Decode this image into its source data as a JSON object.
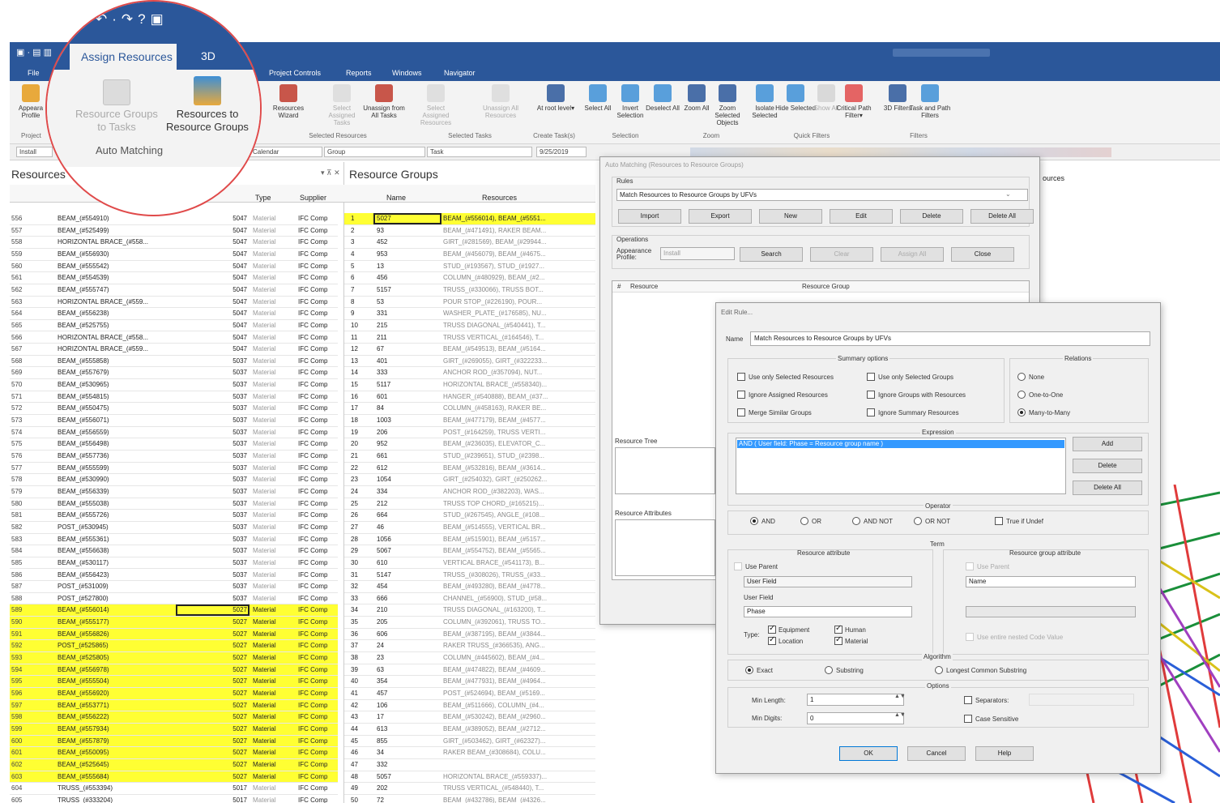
{
  "quick_access": {
    "undo": "↶",
    "redo": "↷",
    "help": "?"
  },
  "ribbon_tabs": {
    "file": "File",
    "assign": "Assign Resources",
    "view3d": "3D"
  },
  "menu": [
    "Project Controls",
    "Reports",
    "Windows",
    "Navigator"
  ],
  "ribbon": {
    "left_partial": [
      "Appeara",
      "Profile",
      "Project"
    ],
    "resource_groups_to_tasks": "Resource Groups to Tasks",
    "resources_to_resource_groups": "Resources to Resource Groups",
    "auto_matching": "Auto Matching",
    "buttons": [
      {
        "label": "Resources Wizard",
        "dis": false
      },
      {
        "label": "Select Assigned Tasks",
        "dis": true
      },
      {
        "label": "Unassign from All Tasks",
        "dis": false
      },
      {
        "label": "Select Assigned Resources",
        "dis": true
      },
      {
        "label": "Unassign All Resources",
        "dis": true
      },
      {
        "label": "At root level▾",
        "dis": false
      },
      {
        "label": "Select All",
        "dis": false
      },
      {
        "label": "Invert Selection",
        "dis": false
      },
      {
        "label": "Deselect All",
        "dis": false
      },
      {
        "label": "Zoom All",
        "dis": false
      },
      {
        "label": "Zoom Selected Objects",
        "dis": false
      },
      {
        "label": "Isolate Selected",
        "dis": false
      },
      {
        "label": "Hide Selected",
        "dis": false
      },
      {
        "label": "Show All",
        "dis": true
      },
      {
        "label": "Critical Path Filter▾",
        "dis": false
      },
      {
        "label": "3D Filters",
        "dis": false
      },
      {
        "label": "Task and Path Filters",
        "dis": false
      }
    ],
    "groups": [
      "Selected Resources",
      "Selected Tasks",
      "Create Task(s)",
      "Selection",
      "Zoom",
      "Quick Filters",
      "Filters"
    ]
  },
  "toolbar": {
    "install": "Install",
    "calendar": "Calendar",
    "group": "Group",
    "task": "Task",
    "date": "9/25/2019"
  },
  "resources_pane": {
    "title": "Resources",
    "search": "FS",
    "headers": {
      "type": "Type",
      "supplier": "Supplier"
    },
    "rows": [
      [
        "556",
        "BEAM_(#554910)",
        "5047",
        "Material",
        "IFC Comp",
        0
      ],
      [
        "557",
        "BEAM_(#525499)",
        "5047",
        "Material",
        "IFC Comp",
        0
      ],
      [
        "558",
        "HORIZONTAL BRACE_(#558...",
        "5047",
        "Material",
        "IFC Comp",
        0
      ],
      [
        "559",
        "BEAM_(#556930)",
        "5047",
        "Material",
        "IFC Comp",
        0
      ],
      [
        "560",
        "BEAM_(#555542)",
        "5047",
        "Material",
        "IFC Comp",
        0
      ],
      [
        "561",
        "BEAM_(#554539)",
        "5047",
        "Material",
        "IFC Comp",
        0
      ],
      [
        "562",
        "BEAM_(#555747)",
        "5047",
        "Material",
        "IFC Comp",
        0
      ],
      [
        "563",
        "HORIZONTAL BRACE_(#559...",
        "5047",
        "Material",
        "IFC Comp",
        0
      ],
      [
        "564",
        "BEAM_(#556238)",
        "5047",
        "Material",
        "IFC Comp",
        0
      ],
      [
        "565",
        "BEAM_(#525755)",
        "5047",
        "Material",
        "IFC Comp",
        0
      ],
      [
        "566",
        "HORIZONTAL BRACE_(#558...",
        "5047",
        "Material",
        "IFC Comp",
        0
      ],
      [
        "567",
        "HORIZONTAL BRACE_(#559...",
        "5047",
        "Material",
        "IFC Comp",
        0
      ],
      [
        "568",
        "BEAM_(#555858)",
        "5037",
        "Material",
        "IFC Comp",
        0
      ],
      [
        "569",
        "BEAM_(#557679)",
        "5037",
        "Material",
        "IFC Comp",
        0
      ],
      [
        "570",
        "BEAM_(#530965)",
        "5037",
        "Material",
        "IFC Comp",
        0
      ],
      [
        "571",
        "BEAM_(#554815)",
        "5037",
        "Material",
        "IFC Comp",
        0
      ],
      [
        "572",
        "BEAM_(#550475)",
        "5037",
        "Material",
        "IFC Comp",
        0
      ],
      [
        "573",
        "BEAM_(#556071)",
        "5037",
        "Material",
        "IFC Comp",
        0
      ],
      [
        "574",
        "BEAM_(#556559)",
        "5037",
        "Material",
        "IFC Comp",
        0
      ],
      [
        "575",
        "BEAM_(#556498)",
        "5037",
        "Material",
        "IFC Comp",
        0
      ],
      [
        "576",
        "BEAM_(#557736)",
        "5037",
        "Material",
        "IFC Comp",
        0
      ],
      [
        "577",
        "BEAM_(#555599)",
        "5037",
        "Material",
        "IFC Comp",
        0
      ],
      [
        "578",
        "BEAM_(#530990)",
        "5037",
        "Material",
        "IFC Comp",
        0
      ],
      [
        "579",
        "BEAM_(#556339)",
        "5037",
        "Material",
        "IFC Comp",
        0
      ],
      [
        "580",
        "BEAM_(#555038)",
        "5037",
        "Material",
        "IFC Comp",
        0
      ],
      [
        "581",
        "BEAM_(#555726)",
        "5037",
        "Material",
        "IFC Comp",
        0
      ],
      [
        "582",
        "POST_(#530945)",
        "5037",
        "Material",
        "IFC Comp",
        0
      ],
      [
        "583",
        "BEAM_(#555361)",
        "5037",
        "Material",
        "IFC Comp",
        0
      ],
      [
        "584",
        "BEAM_(#556638)",
        "5037",
        "Material",
        "IFC Comp",
        0
      ],
      [
        "585",
        "BEAM_(#530117)",
        "5037",
        "Material",
        "IFC Comp",
        0
      ],
      [
        "586",
        "BEAM_(#556423)",
        "5037",
        "Material",
        "IFC Comp",
        0
      ],
      [
        "587",
        "POST_(#531009)",
        "5037",
        "Material",
        "IFC Comp",
        0
      ],
      [
        "588",
        "POST_(#527800)",
        "5037",
        "Material",
        "IFC Comp",
        0
      ],
      [
        "589",
        "BEAM_(#556014)",
        "5027",
        "Material",
        "IFC Comp",
        1
      ],
      [
        "590",
        "BEAM_(#555177)",
        "5027",
        "Material",
        "IFC Comp",
        1
      ],
      [
        "591",
        "BEAM_(#556826)",
        "5027",
        "Material",
        "IFC Comp",
        1
      ],
      [
        "592",
        "POST_(#525865)",
        "5027",
        "Material",
        "IFC Comp",
        1
      ],
      [
        "593",
        "BEAM_(#525805)",
        "5027",
        "Material",
        "IFC Comp",
        1
      ],
      [
        "594",
        "BEAM_(#556978)",
        "5027",
        "Material",
        "IFC Comp",
        1
      ],
      [
        "595",
        "BEAM_(#555504)",
        "5027",
        "Material",
        "IFC Comp",
        1
      ],
      [
        "596",
        "BEAM_(#556920)",
        "5027",
        "Material",
        "IFC Comp",
        1
      ],
      [
        "597",
        "BEAM_(#553771)",
        "5027",
        "Material",
        "IFC Comp",
        1
      ],
      [
        "598",
        "BEAM_(#556222)",
        "5027",
        "Material",
        "IFC Comp",
        1
      ],
      [
        "599",
        "BEAM_(#557934)",
        "5027",
        "Material",
        "IFC Comp",
        1
      ],
      [
        "600",
        "BEAM_(#557879)",
        "5027",
        "Material",
        "IFC Comp",
        1
      ],
      [
        "601",
        "BEAM_(#550095)",
        "5027",
        "Material",
        "IFC Comp",
        1
      ],
      [
        "602",
        "BEAM_(#525645)",
        "5027",
        "Material",
        "IFC Comp",
        1
      ],
      [
        "603",
        "BEAM_(#555684)",
        "5027",
        "Material",
        "IFC Comp",
        1
      ],
      [
        "604",
        "TRUSS_(#553394)",
        "5017",
        "Material",
        "IFC Comp",
        0
      ],
      [
        "605",
        "TRUSS_(#333204)",
        "5017",
        "Material",
        "IFC Comp",
        0
      ]
    ]
  },
  "groups_pane": {
    "title": "Resource Groups",
    "headers": {
      "name": "Name",
      "resources": "Resources"
    },
    "rows": [
      [
        "1",
        "5027",
        "BEAM_(#556014), BEAM_(#5551...",
        1
      ],
      [
        "2",
        "93",
        "BEAM_(#471491), RAKER BEAM...",
        0
      ],
      [
        "3",
        "452",
        "GIRT_(#281569), BEAM_(#29944...",
        0
      ],
      [
        "4",
        "953",
        "BEAM_(#456079), BEAM_(#4675...",
        0
      ],
      [
        "5",
        "13",
        "STUD_(#193567), STUD_(#1927...",
        0
      ],
      [
        "6",
        "456",
        "COLUMN_(#480929), BEAM_(#2...",
        0
      ],
      [
        "7",
        "5157",
        "TRUSS_(#330066), TRUSS BOT...",
        0
      ],
      [
        "8",
        "53",
        "POUR STOP_(#226190), POUR...",
        0
      ],
      [
        "9",
        "331",
        "WASHER_PLATE_(#176585), NU...",
        0
      ],
      [
        "10",
        "215",
        "TRUSS DIAGONAL_(#540441), T...",
        0
      ],
      [
        "11",
        "211",
        "TRUSS VERTICAL_(#164546), T...",
        0
      ],
      [
        "12",
        "67",
        "BEAM_(#549513), BEAM_(#5164...",
        0
      ],
      [
        "13",
        "401",
        "GIRT_(#269055), GIRT_(#322233...",
        0
      ],
      [
        "14",
        "333",
        "ANCHOR ROD_(#357094), NUT...",
        0
      ],
      [
        "15",
        "5117",
        "HORIZONTAL BRACE_(#558340)...",
        0
      ],
      [
        "16",
        "601",
        "HANGER_(#540888), BEAM_(#37...",
        0
      ],
      [
        "17",
        "84",
        "COLUMN_(#458163), RAKER BE...",
        0
      ],
      [
        "18",
        "1003",
        "BEAM_(#477179), BEAM_(#4577...",
        0
      ],
      [
        "19",
        "206",
        "POST_(#164259), TRUSS VERTI...",
        0
      ],
      [
        "20",
        "952",
        "BEAM_(#236035), ELEVATOR_C...",
        0
      ],
      [
        "21",
        "661",
        "STUD_(#239651), STUD_(#2398...",
        0
      ],
      [
        "22",
        "612",
        "BEAM_(#532816), BEAM_(#3614...",
        0
      ],
      [
        "23",
        "1054",
        "GIRT_(#254032), GIRT_(#250262...",
        0
      ],
      [
        "24",
        "334",
        "ANCHOR ROD_(#382203), WAS...",
        0
      ],
      [
        "25",
        "212",
        "TRUSS TOP CHORD_(#165215)...",
        0
      ],
      [
        "26",
        "664",
        "STUD_(#267545), ANGLE_(#108...",
        0
      ],
      [
        "27",
        "46",
        "BEAM_(#514555), VERTICAL BR...",
        0
      ],
      [
        "28",
        "1056",
        "BEAM_(#515901), BEAM_(#5157...",
        0
      ],
      [
        "29",
        "5067",
        "BEAM_(#554752), BEAM_(#5565...",
        0
      ],
      [
        "30",
        "610",
        "VERTICAL BRACE_(#541173), B...",
        0
      ],
      [
        "31",
        "5147",
        "TRUSS_(#308026), TRUSS_(#33...",
        0
      ],
      [
        "32",
        "454",
        "BEAM_(#493280), BEAM_(#4778...",
        0
      ],
      [
        "33",
        "666",
        "CHANNEL_(#56900), STUD_(#58...",
        0
      ],
      [
        "34",
        "210",
        "TRUSS DIAGONAL_(#163200), T...",
        0
      ],
      [
        "35",
        "205",
        "COLUMN_(#392061), TRUSS TO...",
        0
      ],
      [
        "36",
        "606",
        "BEAM_(#387195), BEAM_(#3844...",
        0
      ],
      [
        "37",
        "24",
        "RAKER TRUSS_(#366535), ANG...",
        0
      ],
      [
        "38",
        "23",
        "COLUMN_(#445602), BEAM_(#4...",
        0
      ],
      [
        "39",
        "63",
        "BEAM_(#474822), BEAM_(#4609...",
        0
      ],
      [
        "40",
        "354",
        "BEAM_(#477931), BEAM_(#4964...",
        0
      ],
      [
        "41",
        "457",
        "POST_(#524694), BEAM_(#5169...",
        0
      ],
      [
        "42",
        "106",
        "BEAM_(#511666), COLUMN_(#4...",
        0
      ],
      [
        "43",
        "17",
        "BEAM_(#530242), BEAM_(#2960...",
        0
      ],
      [
        "44",
        "613",
        "BEAM_(#389052), BEAM_(#2712...",
        0
      ],
      [
        "45",
        "855",
        "GIRT_(#503462), GIRT_(#62327)...",
        0
      ],
      [
        "46",
        "34",
        "RAKER BEAM_(#308684), COLU...",
        0
      ],
      [
        "47",
        "332",
        "",
        0
      ],
      [
        "48",
        "5057",
        "HORIZONTAL BRACE_(#559337)...",
        0
      ],
      [
        "49",
        "202",
        "TRUSS VERTICAL_(#548440), T...",
        0
      ],
      [
        "50",
        "72",
        "BEAM_(#432786), BEAM_(#4326...",
        0
      ]
    ]
  },
  "auto_matching": {
    "title": "Auto Matching (Resources to Resource Groups)",
    "rules_label": "Rules",
    "rules_value": "Match Resources to Resource Groups by UFVs",
    "buttons": [
      "Import",
      "Export",
      "New",
      "Edit",
      "Delete",
      "Delete All"
    ],
    "operations_label": "Operations",
    "appearance_label": "Appearance Profile:",
    "appearance_value": "Install",
    "op_buttons": [
      "Search",
      "Clear",
      "Assign All",
      "Close"
    ],
    "col_hash": "#",
    "col_resource": "Resource",
    "col_group": "Resource Group",
    "tree_label": "Resource Tree",
    "attributes_label": "Resource Attributes",
    "right_header": "ources"
  },
  "edit_rule": {
    "title": "Edit Rule...",
    "name_label": "Name",
    "name_value": "Match Resources to Resource Groups by UFVs",
    "summary_label": "Summary options",
    "relations_label": "Relations",
    "checks": [
      "Use only Selected Resources",
      "Use only Selected Groups",
      "Ignore Assigned Resources",
      "Ignore Groups with Resources",
      "Merge Similar Groups",
      "Ignore Summary Resources"
    ],
    "relations": [
      "None",
      "One-to-One",
      "Many-to-Many"
    ],
    "expression_label": "Expression",
    "expression_value": "AND ( User field: Phase = Resource group name )",
    "expr_buttons": [
      "Add",
      "Delete",
      "Delete All"
    ],
    "operator_label": "Operator",
    "operators": [
      "AND",
      "OR",
      "AND NOT",
      "OR NOT"
    ],
    "true_if_undef": "True if Undef",
    "term_label": "Term",
    "res_attr_label": "Resource attribute",
    "grp_attr_label": "Resource group attribute",
    "use_parent": "Use Parent",
    "user_field": "User Field",
    "user_field_label": "User Field",
    "phase": "Phase",
    "name_select": "Name",
    "type_label": "Type:",
    "types": [
      "Equipment",
      "Human",
      "Location",
      "Material"
    ],
    "use_entire": "Use entire nested Code Value",
    "algorithm_label": "Algorithm",
    "algorithms": [
      "Exact",
      "Substring",
      "Longest Common Substring"
    ],
    "options_label": "Options",
    "min_length_label": "Min Length:",
    "min_length": "1",
    "min_digits_label": "Min Digits:",
    "min_digits": "0",
    "separators": "Separators:",
    "case_sensitive": "Case Sensitive",
    "ok": "OK",
    "cancel": "Cancel",
    "help": "Help"
  },
  "colors": {
    "accent": "#2b579a",
    "highlight": "#ffff33",
    "callout": "#e04a4a"
  }
}
